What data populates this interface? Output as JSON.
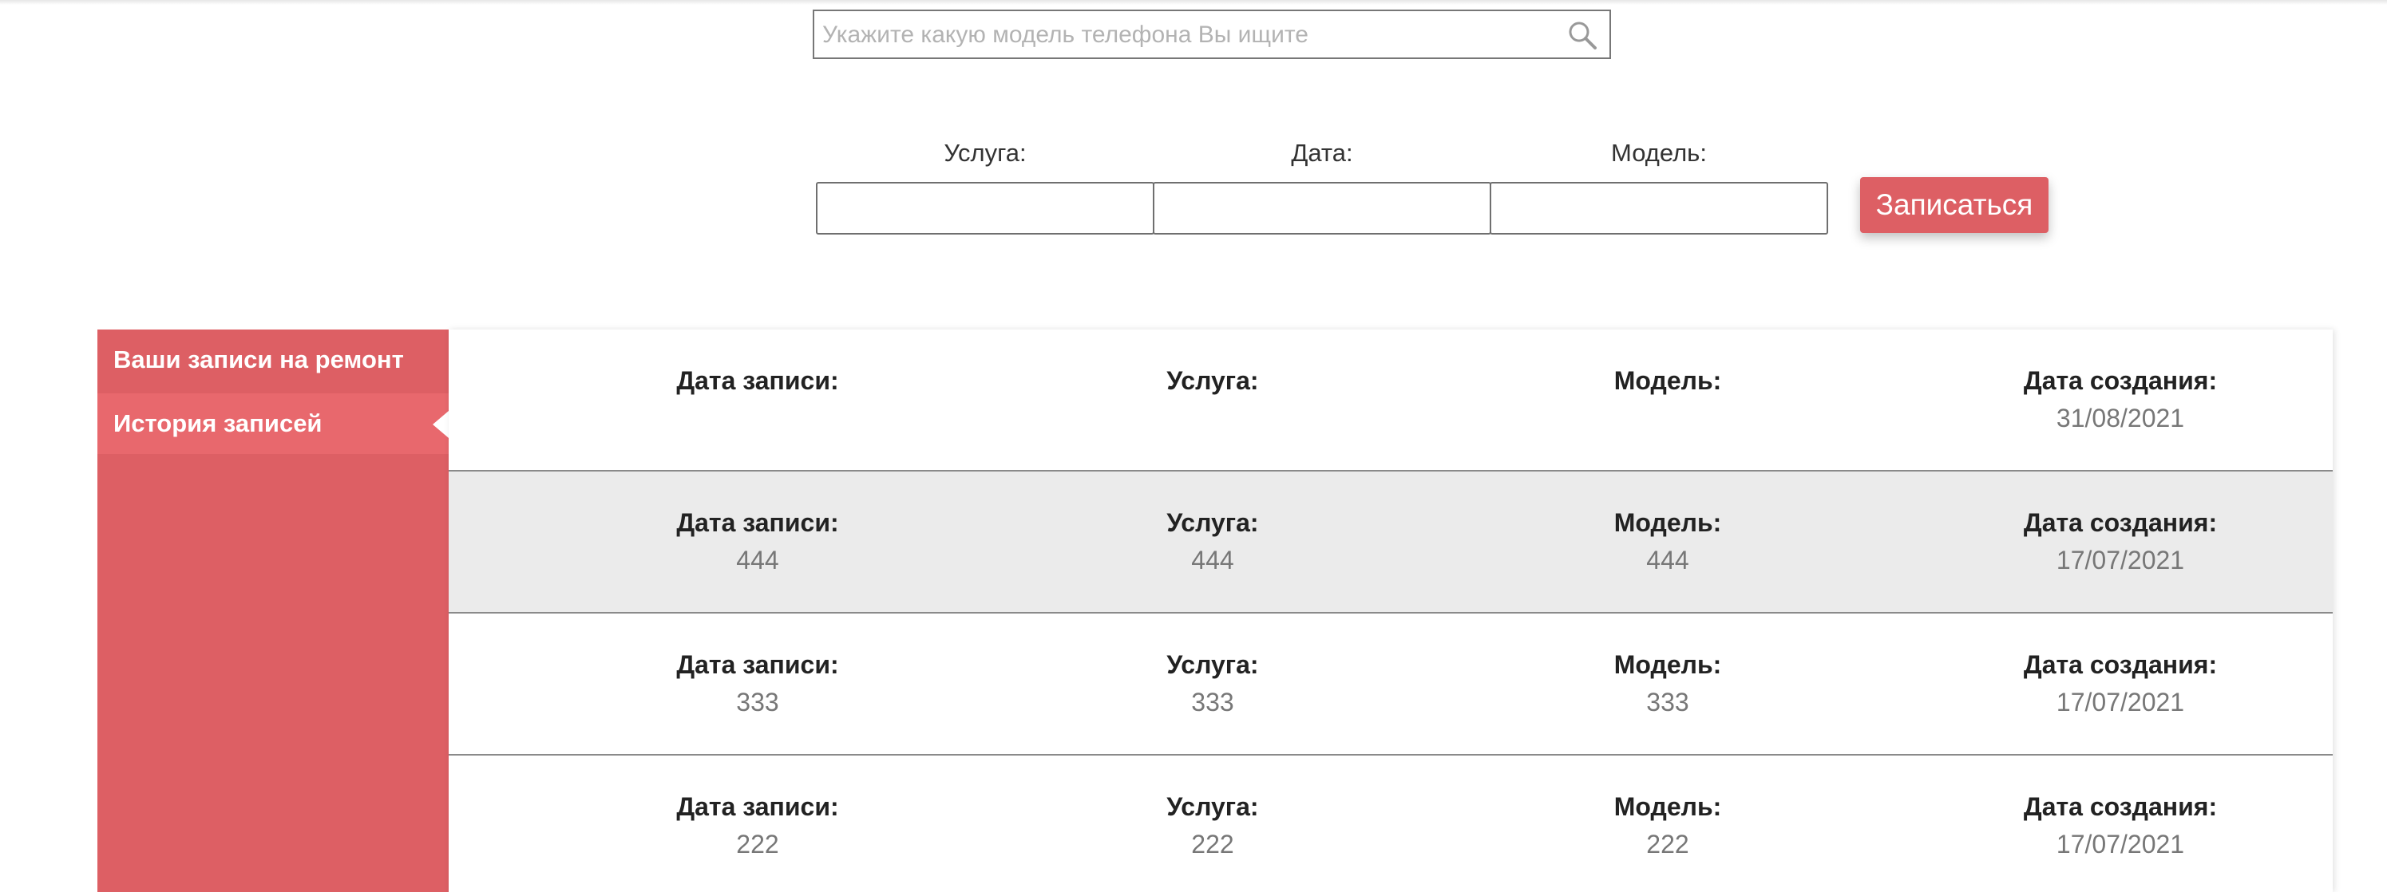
{
  "search": {
    "placeholder": "Укажите какую модель телефона Вы ищите",
    "icon": "search-icon"
  },
  "form": {
    "service_label": "Услуга:",
    "date_label": "Дата:",
    "model_label": "Модель:",
    "service_value": "",
    "date_value": "",
    "model_value": "",
    "submit_label": "Записаться"
  },
  "sidebar": {
    "items": [
      {
        "label": "Ваши записи на ремонт"
      },
      {
        "label": "История записей",
        "active": true
      }
    ]
  },
  "table": {
    "headers": {
      "date": "Дата записи:",
      "service": "Услуга:",
      "model": "Модель:",
      "created": "Дата создания:"
    },
    "rows": [
      {
        "date": "",
        "service": "",
        "model": "",
        "created": "31/08/2021"
      },
      {
        "date": "444",
        "service": "444",
        "model": "444",
        "created": "17/07/2021"
      },
      {
        "date": "333",
        "service": "333",
        "model": "333",
        "created": "17/07/2021"
      },
      {
        "date": "222",
        "service": "222",
        "model": "222",
        "created": "17/07/2021"
      }
    ]
  },
  "colors": {
    "accent": "#dd5f64",
    "accent_active": "#e8686d",
    "row_shade": "#ebebeb"
  }
}
